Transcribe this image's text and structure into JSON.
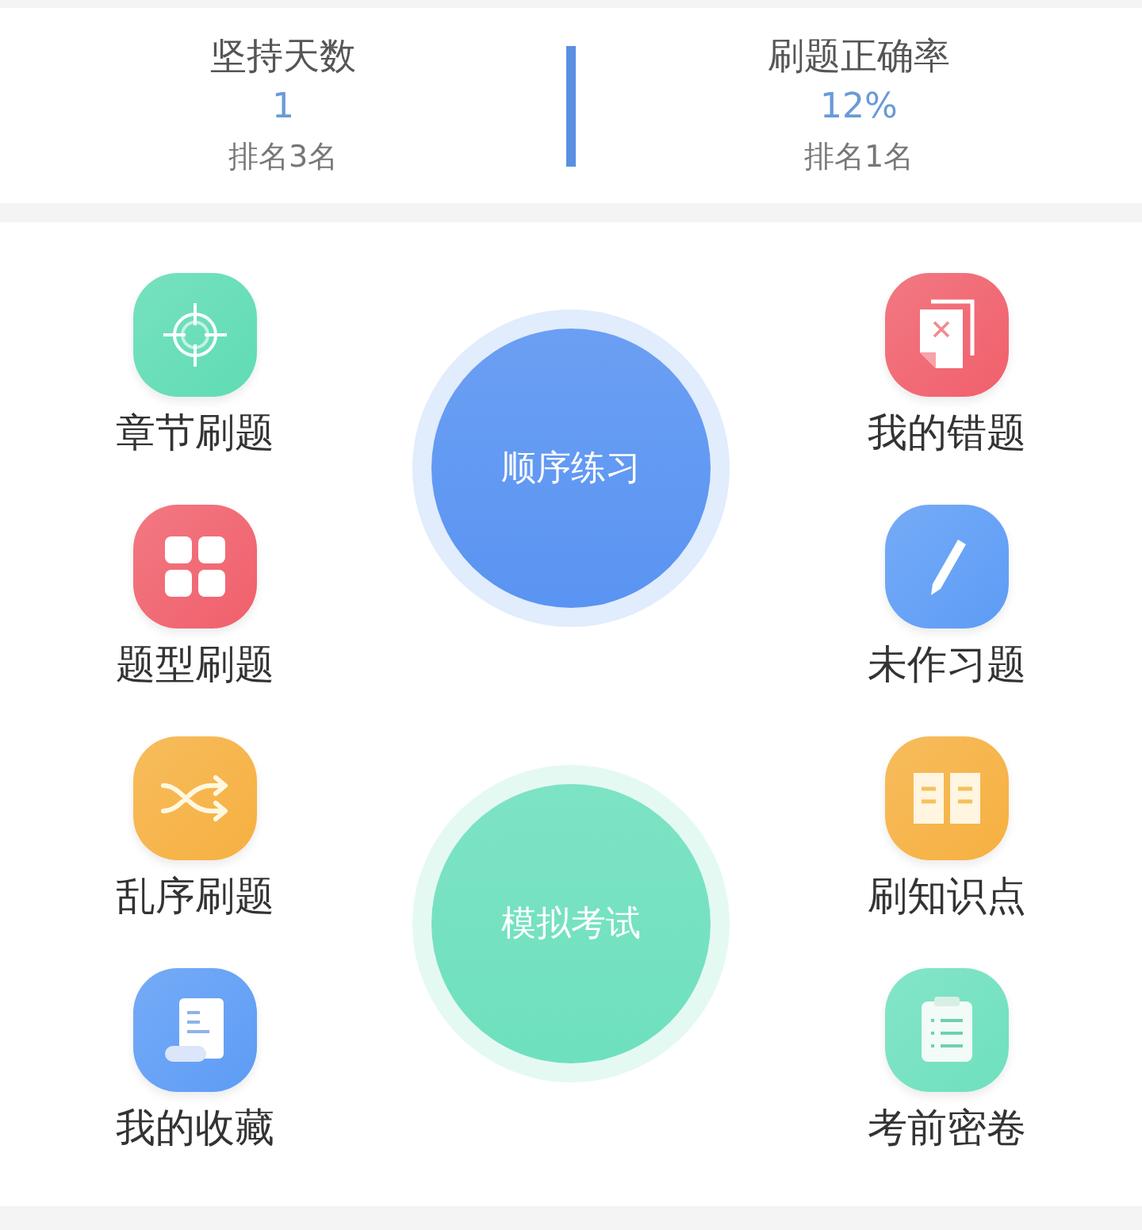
{
  "stats": [
    {
      "label": "坚持天数",
      "value": "1",
      "rank": "排名3名"
    },
    {
      "label": "刷题正确率",
      "value": "12%",
      "rank": "排名1名"
    }
  ],
  "left_items": [
    {
      "label": "章节刷题",
      "kind": "target",
      "color": "#5fdcb4"
    },
    {
      "label": "题型刷题",
      "kind": "grid",
      "color": "#f0606c"
    },
    {
      "label": "乱序刷题",
      "kind": "shuffle",
      "color": "#f6b040"
    },
    {
      "label": "我的收藏",
      "kind": "scroll",
      "color": "#5d9cf5"
    }
  ],
  "circles": [
    {
      "label": "顺序练习",
      "color": "#5a94f2"
    },
    {
      "label": "模拟考试",
      "color": "#6ee0be"
    }
  ],
  "right_items": [
    {
      "label": "我的错题",
      "kind": "wrong-doc",
      "color": "#f0606c"
    },
    {
      "label": "未作习题",
      "kind": "pencil",
      "color": "#5d9cf5"
    },
    {
      "label": "刷知识点",
      "kind": "book",
      "color": "#f6b040"
    },
    {
      "label": "考前密卷",
      "kind": "clipboard",
      "color": "#6ee0be"
    }
  ]
}
